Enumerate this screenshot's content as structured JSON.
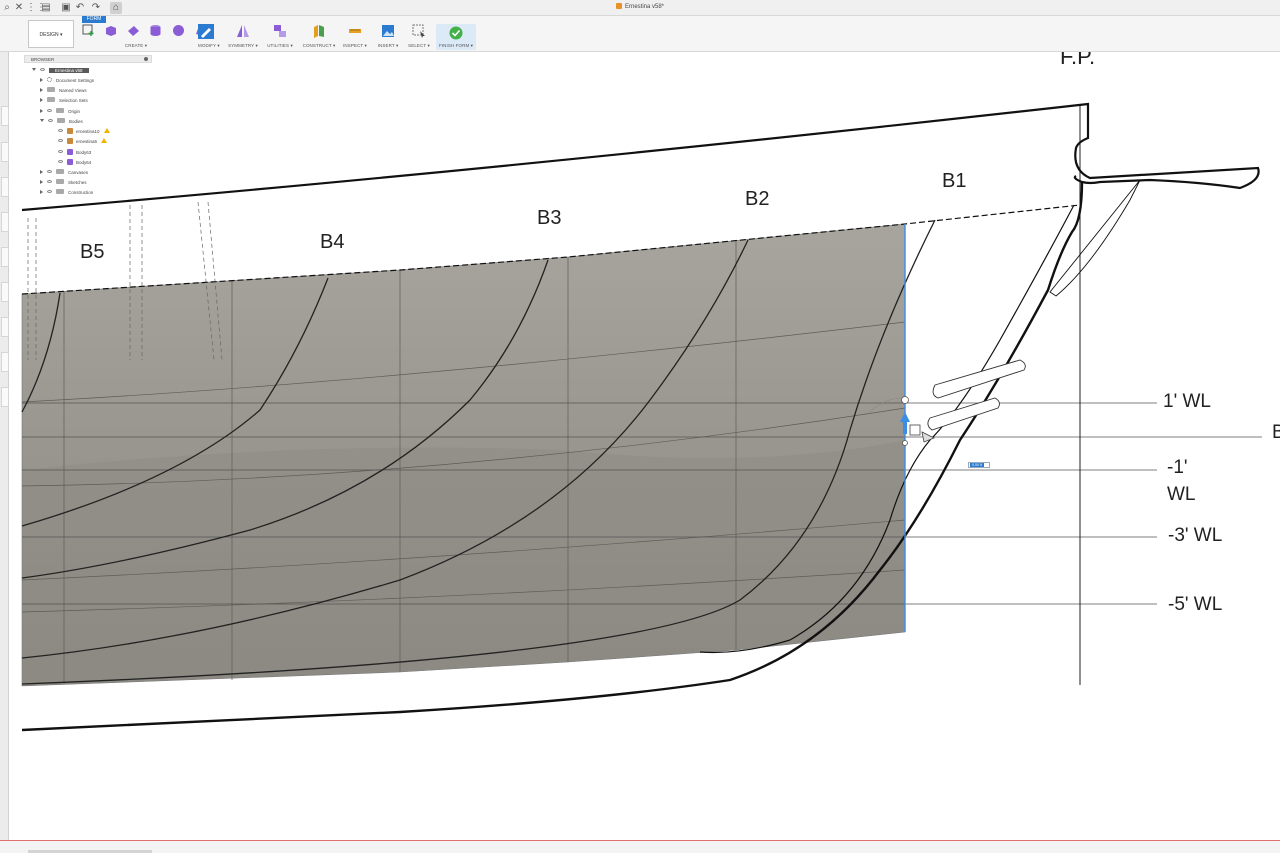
{
  "window": {
    "title": "Ernestina v58*"
  },
  "toolbar": {
    "workspace_label": "DESIGN",
    "active_tab": "FORM",
    "groups": [
      {
        "id": "create",
        "label": "CREATE ▾"
      },
      {
        "id": "modify",
        "label": "MODIFY ▾"
      },
      {
        "id": "symmetry",
        "label": "SYMMETRY ▾"
      },
      {
        "id": "utilities",
        "label": "UTILITIES ▾"
      },
      {
        "id": "construct",
        "label": "CONSTRUCT ▾"
      },
      {
        "id": "inspect",
        "label": "INSPECT ▾"
      },
      {
        "id": "insert",
        "label": "INSERT ▾"
      },
      {
        "id": "select",
        "label": "SELECT ▾"
      },
      {
        "id": "finish",
        "label": "FINISH FORM ▾"
      }
    ]
  },
  "browser": {
    "title": "BROWSER",
    "root": "Ernestina v58",
    "items": [
      {
        "label": "Document Settings"
      },
      {
        "label": "Named Views"
      },
      {
        "label": "Selection Sets"
      },
      {
        "label": "Origin"
      },
      {
        "label": "Bodies"
      },
      {
        "label": "ernestina10"
      },
      {
        "label": "ernestina5"
      },
      {
        "label": "Body63"
      },
      {
        "label": "Body64"
      },
      {
        "label": "Canvases"
      },
      {
        "label": "Sketches"
      },
      {
        "label": "Construction"
      }
    ]
  },
  "drawing": {
    "labels": {
      "fp": "F.P.",
      "b1": "B1",
      "b2": "B2",
      "b3": "B3",
      "b4": "B4",
      "b5": "B5",
      "wl1": "1' WL",
      "wl_minus1_a": "-1'",
      "wl_minus1_b": "WL",
      "wl_minus3": "-3' WL",
      "wl_minus5": "-5' WL",
      "edge_b": "B"
    },
    "colors": {
      "surface": "#9d9b92",
      "surface_dark": "#8c8a82",
      "line": "#111111",
      "selection": "#3a8ee6"
    }
  },
  "dimension_input": {
    "value": "0.00 ft"
  }
}
